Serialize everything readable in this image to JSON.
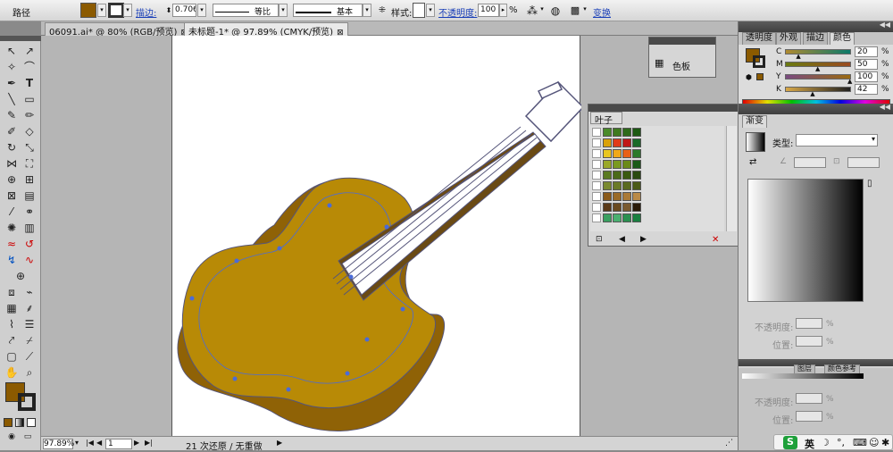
{
  "control_bar": {
    "selection_label": "路径",
    "fill_color": "#8b5a00",
    "stroke_label": "描边:",
    "stroke_value": "0.706",
    "profile_label": "等比",
    "brush_label": "基本",
    "style_label": "样式:",
    "opacity_label": "不透明度:",
    "opacity_value": "100",
    "percent": "%",
    "transform_label": "变换"
  },
  "tabs": [
    {
      "label": "06091.ai* @ 80% (RGB/预览)",
      "close": "⊠"
    },
    {
      "label": "未标题-1* @ 97.89% (CMYK/预览)",
      "close": "⊠"
    }
  ],
  "status": {
    "zoom": "97.89%",
    "page": "1",
    "history": "21 次还原 / 无重做"
  },
  "color_panel": {
    "tabs": [
      "透明度",
      "外观",
      "描边",
      "颜色"
    ],
    "active_tab": "颜色",
    "channels": [
      {
        "name": "C",
        "value": "20",
        "pos": 0.2
      },
      {
        "name": "M",
        "value": "50",
        "pos": 0.5
      },
      {
        "name": "Y",
        "value": "100",
        "pos": 1.0
      },
      {
        "name": "K",
        "value": "42",
        "pos": 0.42
      }
    ],
    "percent": "%"
  },
  "swatch_popup": {
    "label": "色板"
  },
  "leaf_panel": {
    "title": "叶子",
    "colors": [
      [
        "#4a8b2a",
        "#3f7a20",
        "#2e6a1a",
        "#1d5a12"
      ],
      [
        "#d9a10a",
        "#e03a1a",
        "#c01818",
        "#1a6a28"
      ],
      [
        "#e8c620",
        "#f0a818",
        "#e86018",
        "#2a7a2a"
      ],
      [
        "#9aa828",
        "#7a9a20",
        "#6a8a18",
        "#1a5a18"
      ],
      [
        "#5a7a20",
        "#4a6a18",
        "#3a5a10",
        "#2a4a10"
      ],
      [
        "#7a8a30",
        "#6a7a28",
        "#5a6a20",
        "#4a5a18"
      ],
      [
        "#8a5a1a",
        "#9a6a28",
        "#aa7a38",
        "#ba8a48"
      ],
      [
        "#5a3a18",
        "#6a4a20",
        "#7a5a30",
        "#2a1a08"
      ],
      [
        "#3aa060",
        "#4ab070",
        "#2a9050",
        "#1a8040"
      ]
    ]
  },
  "gradient_panel": {
    "title": "渐变",
    "type_label": "类型:",
    "opacity_label": "不透明度:",
    "location_label": "位置:",
    "percent": "%"
  },
  "bottom_panel": {
    "tabs": [
      "图层",
      "颜色参考"
    ]
  },
  "ime": {
    "label": "英"
  },
  "artwork": {
    "body_color": "#b88a06",
    "shadow_color": "#8f6206",
    "outline_color": "#55557a",
    "anchor_color": "#4a6bd8"
  }
}
